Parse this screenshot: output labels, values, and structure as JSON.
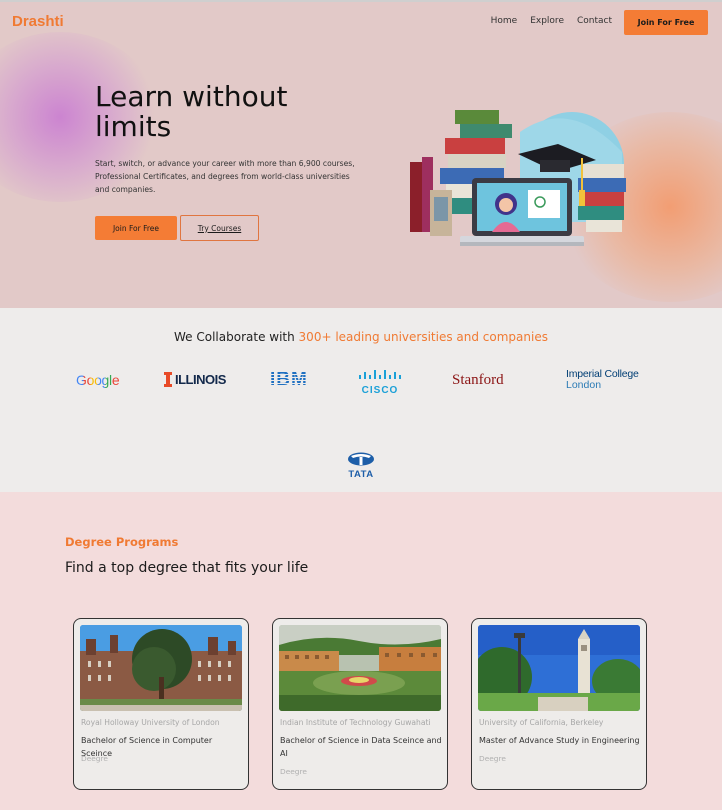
{
  "brand": {
    "name": "Drashti",
    "accent": "#f47c35"
  },
  "nav": {
    "links": [
      "Home",
      "Explore",
      "Contact"
    ],
    "cta": "Join For Free"
  },
  "hero": {
    "title": "Learn without limits",
    "subtitle": "Start, switch, or advance your career with more than 6,900 courses, Professional Certificates, and degrees from world-class universities and companies.",
    "primary_button": "Join For Free",
    "secondary_button": "Try Courses",
    "illustration": "books-laptop-graduation-cap-illustration"
  },
  "partners": {
    "heading_prefix": "We Collaborate with ",
    "heading_highlight": "300+ leading universities and companies",
    "logos": [
      {
        "name": "Google"
      },
      {
        "name": "ILLINOIS"
      },
      {
        "name": "IBM"
      },
      {
        "name": "CISCO"
      },
      {
        "name": "Stanford"
      },
      {
        "name": "Imperial College",
        "sub": "London"
      },
      {
        "name": "TATA"
      }
    ]
  },
  "degrees": {
    "label": "Degree Programs",
    "title": "Find a top degree that fits your life",
    "cards": [
      {
        "institution": "Royal Holloway University of London",
        "program": "Bachelor of Science in Computer Sceince",
        "type": "Deegre",
        "image": "royal-holloway-building-photo"
      },
      {
        "institution": "Indian Institute of Technology Guwahati",
        "program": "Bachelor of Science in Data Sceince and AI",
        "type": "Deegre",
        "image": "iit-guwahati-campus-photo"
      },
      {
        "institution": "University of California, Berkeley",
        "program": "Master of Advance Study in Engineering",
        "type": "Deegre",
        "image": "berkeley-campanile-photo"
      }
    ]
  }
}
